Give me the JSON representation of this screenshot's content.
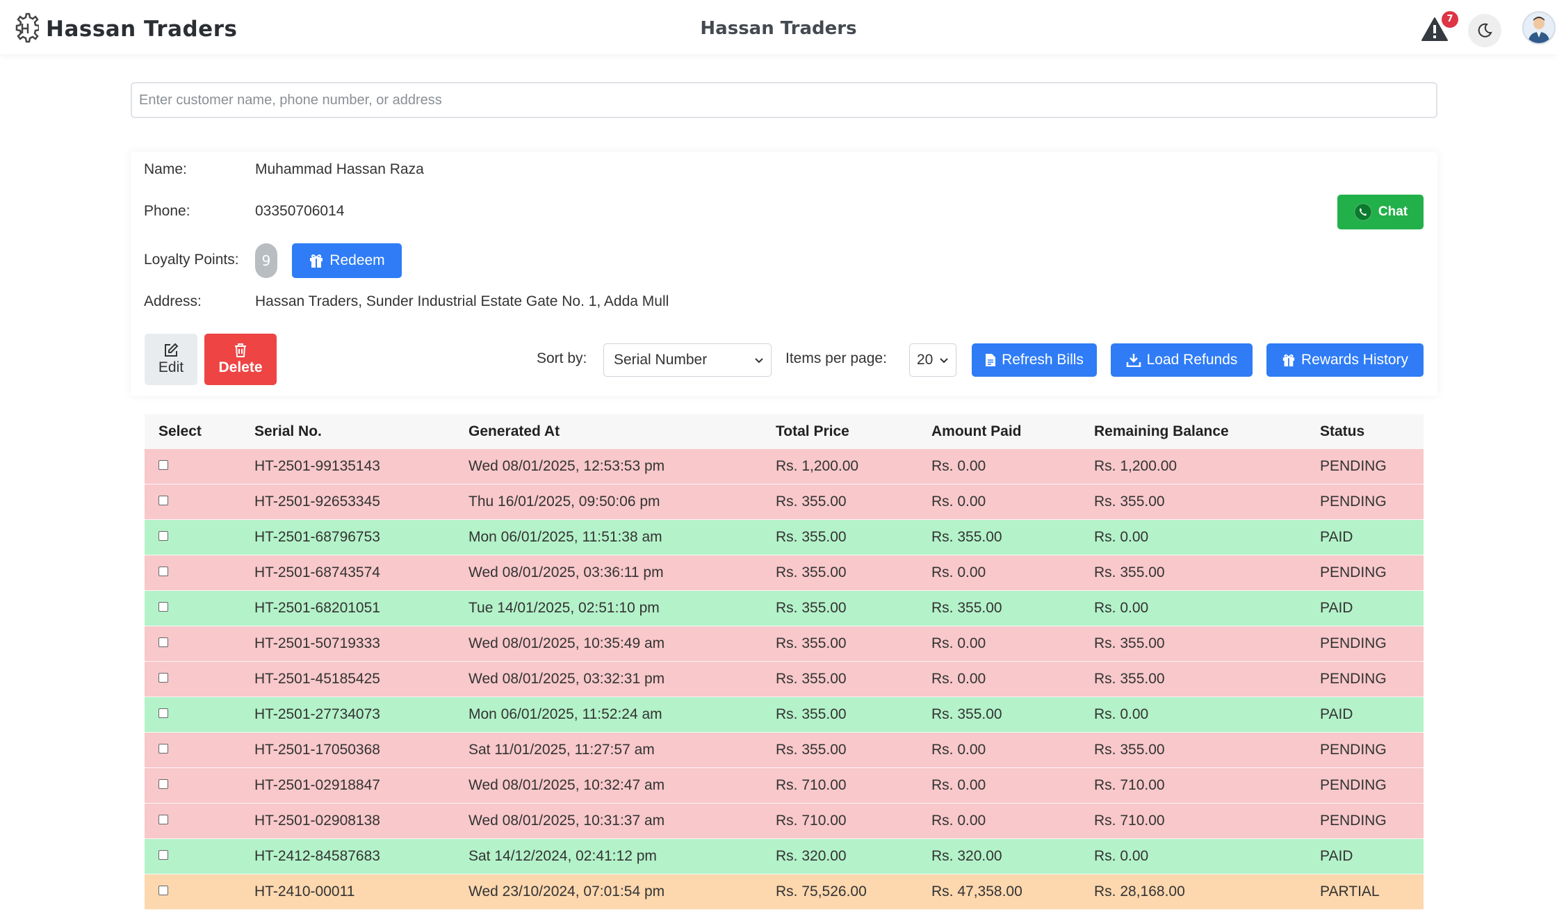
{
  "header": {
    "brand": "Hassan Traders",
    "title": "Hassan Traders",
    "alert_count": "7"
  },
  "search": {
    "placeholder": "Enter customer name, phone number, or address"
  },
  "customer": {
    "name_label": "Name:",
    "name": "Muhammad Hassan Raza",
    "phone_label": "Phone:",
    "phone": "03350706014",
    "points_label": "Loyalty Points:",
    "points": "9",
    "address_label": "Address:",
    "address": "Hassan Traders, Sunder Industrial Estate Gate No. 1, Adda Mull"
  },
  "actions": {
    "chat": "Chat",
    "redeem": "Redeem",
    "edit": "Edit",
    "delete": "Delete",
    "sort_label": "Sort by:",
    "sort_value": "Serial Number",
    "per_page_label": "Items per page:",
    "per_page_value": "20",
    "refresh": "Refresh Bills",
    "load_refunds": "Load Refunds",
    "rewards": "Rewards History"
  },
  "table": {
    "headers": [
      "Select",
      "Serial No.",
      "Generated At",
      "Total Price",
      "Amount Paid",
      "Remaining Balance",
      "Status"
    ],
    "rows": [
      {
        "serial": "HT-2501-99135143",
        "generated": "Wed 08/01/2025, 12:53:53 pm",
        "total": "Rs. 1,200.00",
        "paid": "Rs. 0.00",
        "remaining": "Rs. 1,200.00",
        "status": "PENDING"
      },
      {
        "serial": "HT-2501-92653345",
        "generated": "Thu 16/01/2025, 09:50:06 pm",
        "total": "Rs. 355.00",
        "paid": "Rs. 0.00",
        "remaining": "Rs. 355.00",
        "status": "PENDING"
      },
      {
        "serial": "HT-2501-68796753",
        "generated": "Mon 06/01/2025, 11:51:38 am",
        "total": "Rs. 355.00",
        "paid": "Rs. 355.00",
        "remaining": "Rs. 0.00",
        "status": "PAID"
      },
      {
        "serial": "HT-2501-68743574",
        "generated": "Wed 08/01/2025, 03:36:11 pm",
        "total": "Rs. 355.00",
        "paid": "Rs. 0.00",
        "remaining": "Rs. 355.00",
        "status": "PENDING"
      },
      {
        "serial": "HT-2501-68201051",
        "generated": "Tue 14/01/2025, 02:51:10 pm",
        "total": "Rs. 355.00",
        "paid": "Rs. 355.00",
        "remaining": "Rs. 0.00",
        "status": "PAID"
      },
      {
        "serial": "HT-2501-50719333",
        "generated": "Wed 08/01/2025, 10:35:49 am",
        "total": "Rs. 355.00",
        "paid": "Rs. 0.00",
        "remaining": "Rs. 355.00",
        "status": "PENDING"
      },
      {
        "serial": "HT-2501-45185425",
        "generated": "Wed 08/01/2025, 03:32:31 pm",
        "total": "Rs. 355.00",
        "paid": "Rs. 0.00",
        "remaining": "Rs. 355.00",
        "status": "PENDING"
      },
      {
        "serial": "HT-2501-27734073",
        "generated": "Mon 06/01/2025, 11:52:24 am",
        "total": "Rs. 355.00",
        "paid": "Rs. 355.00",
        "remaining": "Rs. 0.00",
        "status": "PAID"
      },
      {
        "serial": "HT-2501-17050368",
        "generated": "Sat 11/01/2025, 11:27:57 am",
        "total": "Rs. 355.00",
        "paid": "Rs. 0.00",
        "remaining": "Rs. 355.00",
        "status": "PENDING"
      },
      {
        "serial": "HT-2501-02918847",
        "generated": "Wed 08/01/2025, 10:32:47 am",
        "total": "Rs. 710.00",
        "paid": "Rs. 0.00",
        "remaining": "Rs. 710.00",
        "status": "PENDING"
      },
      {
        "serial": "HT-2501-02908138",
        "generated": "Wed 08/01/2025, 10:31:37 am",
        "total": "Rs. 710.00",
        "paid": "Rs. 0.00",
        "remaining": "Rs. 710.00",
        "status": "PENDING"
      },
      {
        "serial": "HT-2412-84587683",
        "generated": "Sat 14/12/2024, 02:41:12 pm",
        "total": "Rs. 320.00",
        "paid": "Rs. 320.00",
        "remaining": "Rs. 0.00",
        "status": "PAID"
      },
      {
        "serial": "HT-2410-00011",
        "generated": "Wed 23/10/2024, 07:01:54 pm",
        "total": "Rs. 75,526.00",
        "paid": "Rs. 47,358.00",
        "remaining": "Rs. 28,168.00",
        "status": "PARTIAL"
      }
    ]
  },
  "colors": {
    "pending_row": "#f8c8ca",
    "paid_row": "#b4f2c9",
    "partial_row": "#fdd7ae",
    "primary": "#2f7cf6",
    "success": "#22b04a",
    "danger": "#ee4444"
  },
  "icons": [
    "gear-logo-icon",
    "warning-icon",
    "moon-icon",
    "avatar",
    "whatsapp-icon",
    "gift-icon",
    "edit-icon",
    "trash-icon",
    "chevron-down-icon",
    "file-icon",
    "download-icon"
  ]
}
